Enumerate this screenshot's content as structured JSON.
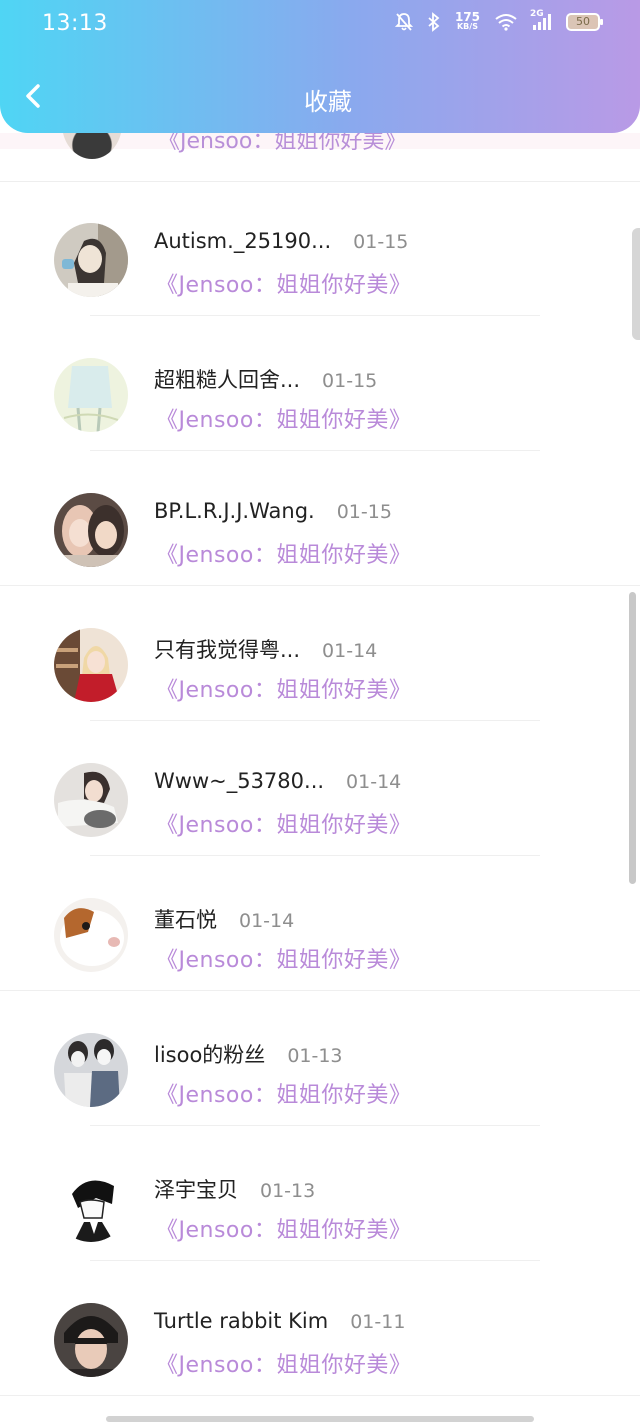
{
  "status_bar": {
    "time": "13:13",
    "net_speed": "175",
    "net_unit": "KB/S",
    "signal_label": "2G",
    "battery": "50"
  },
  "header": {
    "title": "收藏"
  },
  "partial_row": {
    "text": "《Jensoo：姐姐你好美》"
  },
  "rows": [
    {
      "name": "Autism._25190...",
      "date": "01-15",
      "message": "《Jensoo：姐姐你好美》",
      "avatar": "avatar-autism"
    },
    {
      "name": "超粗糙人回舍...",
      "date": "01-15",
      "message": "《Jensoo：姐姐你好美》",
      "avatar": "avatar-sketch"
    },
    {
      "name": "BP.L.R.J.J.Wang.",
      "date": "01-15",
      "message": "《Jensoo：姐姐你好美》",
      "avatar": "avatar-bp"
    },
    {
      "name": "只有我觉得粤...",
      "date": "01-14",
      "message": "《Jensoo：姐姐你好美》",
      "avatar": "avatar-red"
    },
    {
      "name": "Www~_53780...",
      "date": "01-14",
      "message": "《Jensoo：姐姐你好美》",
      "avatar": "avatar-www"
    },
    {
      "name": "董石悦",
      "date": "01-14",
      "message": "《Jensoo：姐姐你好美》",
      "avatar": "avatar-guinea"
    },
    {
      "name": "lisoo的粉丝",
      "date": "01-13",
      "message": "《Jensoo：姐姐你好美》",
      "avatar": "avatar-lisoo"
    },
    {
      "name": "泽宇宝贝",
      "date": "01-13",
      "message": "《Jensoo：姐姐你好美》",
      "avatar": "avatar-anime"
    },
    {
      "name": "Turtle rabbit Kim",
      "date": "01-11",
      "message": "《Jensoo：姐姐你好美》",
      "avatar": "avatar-kim"
    }
  ]
}
